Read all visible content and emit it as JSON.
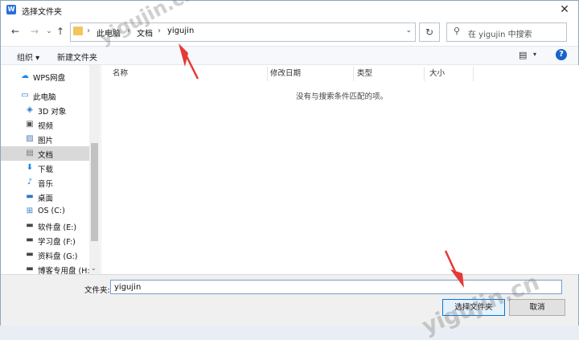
{
  "window": {
    "title": "选择文件夹"
  },
  "nav": {
    "back": "←",
    "forward": "→",
    "up": "↑",
    "breadcrumb": [
      "此电脑",
      "文档",
      "yigujin"
    ],
    "refresh": "↻"
  },
  "search": {
    "placeholder": "在 yigujin 中搜索"
  },
  "toolbar": {
    "organize": "组织 ▾",
    "new_folder": "新建文件夹"
  },
  "sidebar": {
    "items": [
      {
        "label": "WPS网盘",
        "icon": "cloud-icon"
      },
      {
        "label": "此电脑",
        "icon": "computer-icon"
      },
      {
        "label": "3D 对象",
        "icon": "3d-objects-icon"
      },
      {
        "label": "视频",
        "icon": "video-icon"
      },
      {
        "label": "图片",
        "icon": "picture-icon"
      },
      {
        "label": "文档",
        "icon": "document-icon"
      },
      {
        "label": "下载",
        "icon": "download-icon"
      },
      {
        "label": "音乐",
        "icon": "music-icon"
      },
      {
        "label": "桌面",
        "icon": "desktop-icon"
      },
      {
        "label": "OS (C:)",
        "icon": "os-drive-icon"
      },
      {
        "label": "软件盘 (E:)",
        "icon": "drive-icon"
      },
      {
        "label": "学习盘 (F:)",
        "icon": "drive-icon"
      },
      {
        "label": "资料盘 (G:)",
        "icon": "drive-icon"
      },
      {
        "label": "博客专用盘 (H:)",
        "icon": "drive-icon"
      }
    ],
    "selected": "文档"
  },
  "columns": [
    "名称",
    "修改日期",
    "类型",
    "大小"
  ],
  "empty_message": "没有与搜索条件匹配的项。",
  "bottom": {
    "folder_label": "文件夹:",
    "folder_value": "yigujin",
    "select_button": "选择文件夹",
    "cancel_button": "取消"
  },
  "watermark": "yigujin.cn",
  "colors": {
    "accent": "#0078d7",
    "selected_bg": "#d9d9d9",
    "arrow": "#e53935"
  }
}
